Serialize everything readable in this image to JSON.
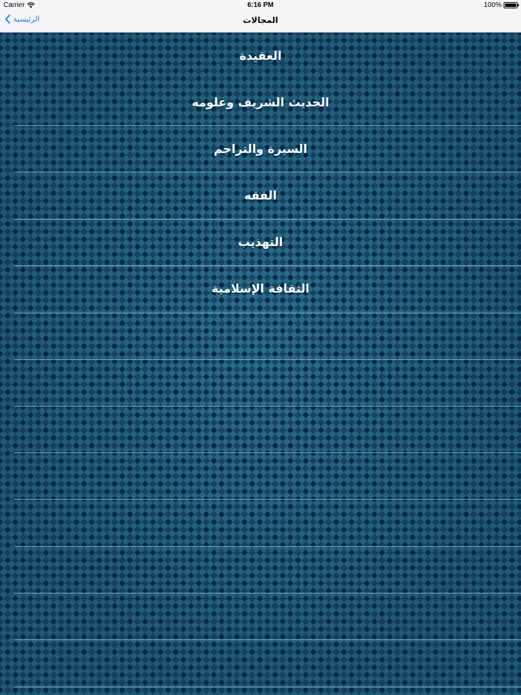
{
  "status_bar": {
    "carrier": "Carrier",
    "time": "6:16 PM",
    "battery": "100%",
    "battery_level": 1.0
  },
  "nav_bar": {
    "title": "المجالات",
    "back_label": "الرئيسية"
  },
  "categories": [
    {
      "label": "العقيدة"
    },
    {
      "label": "الحديث الشريف وعلومه"
    },
    {
      "label": "السيرة والتراجم"
    },
    {
      "label": "الفقه"
    },
    {
      "label": "التهذيب"
    },
    {
      "label": "الثقافة الإسلامية"
    }
  ],
  "colors": {
    "bar_background": "#f5f5f7",
    "accent": "#1e7cf0",
    "content_background": "#1d5b75",
    "row_text": "#ffffff"
  }
}
